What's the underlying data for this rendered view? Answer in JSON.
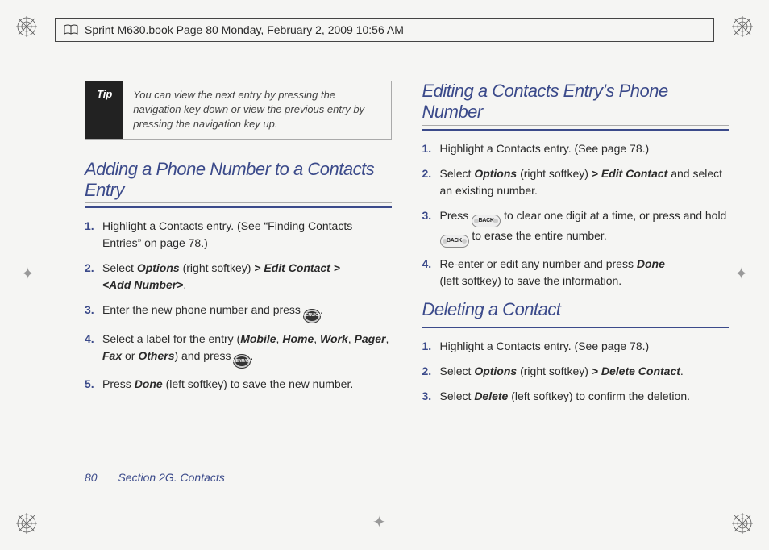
{
  "header": {
    "text": "Sprint M630.book  Page 80  Monday, February 2, 2009  10:56 AM"
  },
  "tip": {
    "label": "Tip",
    "body": "You can view the next entry by pressing the navigation key down or view the previous entry by pressing the navigation key up."
  },
  "left": {
    "heading": "Adding a Phone Number to a Contacts Entry",
    "steps": {
      "s1": "Highlight a Contacts entry. (See “Finding Contacts Entries” on page 78.)",
      "s2a": "Select ",
      "s2b": "Options",
      "s2c": " (right softkey) ",
      "s2d": "> ",
      "s2e": "Edit Contact",
      "s2f": " > ",
      "s2g": "<Add Number>",
      "s2h": ".",
      "s3a": "Enter the new phone number and press ",
      "s3b": "MENU/OK",
      "s3c": ".",
      "s4a": "Select a label for the entry (",
      "s4b": "Mobile",
      "s4c": ", ",
      "s4d": "Home",
      "s4e": ", ",
      "s4f": "Work",
      "s4g": ", ",
      "s4h": "Pager",
      "s4i": ", ",
      "s4j": "Fax",
      "s4k": " or ",
      "s4l": "Others",
      "s4m": ") and press ",
      "s4n": "MENU/OK",
      "s4o": ".",
      "s5a": "Press ",
      "s5b": "Done",
      "s5c": " (left softkey) to save the new number."
    }
  },
  "right": {
    "heading1": "Editing a Contacts Entry’s Phone Number",
    "steps1": {
      "s1": "Highlight a Contacts entry. (See page 78.)",
      "s2a": "Select ",
      "s2b": "Options",
      "s2c": " (right softkey) ",
      "s2d": "> ",
      "s2e": "Edit Contact",
      "s2f": " and select an existing number.",
      "s3a": "Press ",
      "s3b": "BACK",
      "s3c": " to clear one digit at a time, or press and hold ",
      "s3d": "BACK",
      "s3e": " to erase the entire number.",
      "s4a": "Re-enter or edit any number and press ",
      "s4b": "Done",
      "s4c": " (left softkey) to save the information."
    },
    "heading2": "Deleting a Contact",
    "steps2": {
      "s1": "Highlight a Contacts entry. (See page 78.)",
      "s2a": "Select ",
      "s2b": "Options",
      "s2c": " (right softkey) ",
      "s2d": "> ",
      "s2e": "Delete Contact",
      "s2f": ".",
      "s3a": "Select ",
      "s3b": "Delete",
      "s3c": " (left softkey) to confirm the deletion."
    }
  },
  "footer": {
    "page": "80",
    "section": "Section 2G. Contacts"
  }
}
